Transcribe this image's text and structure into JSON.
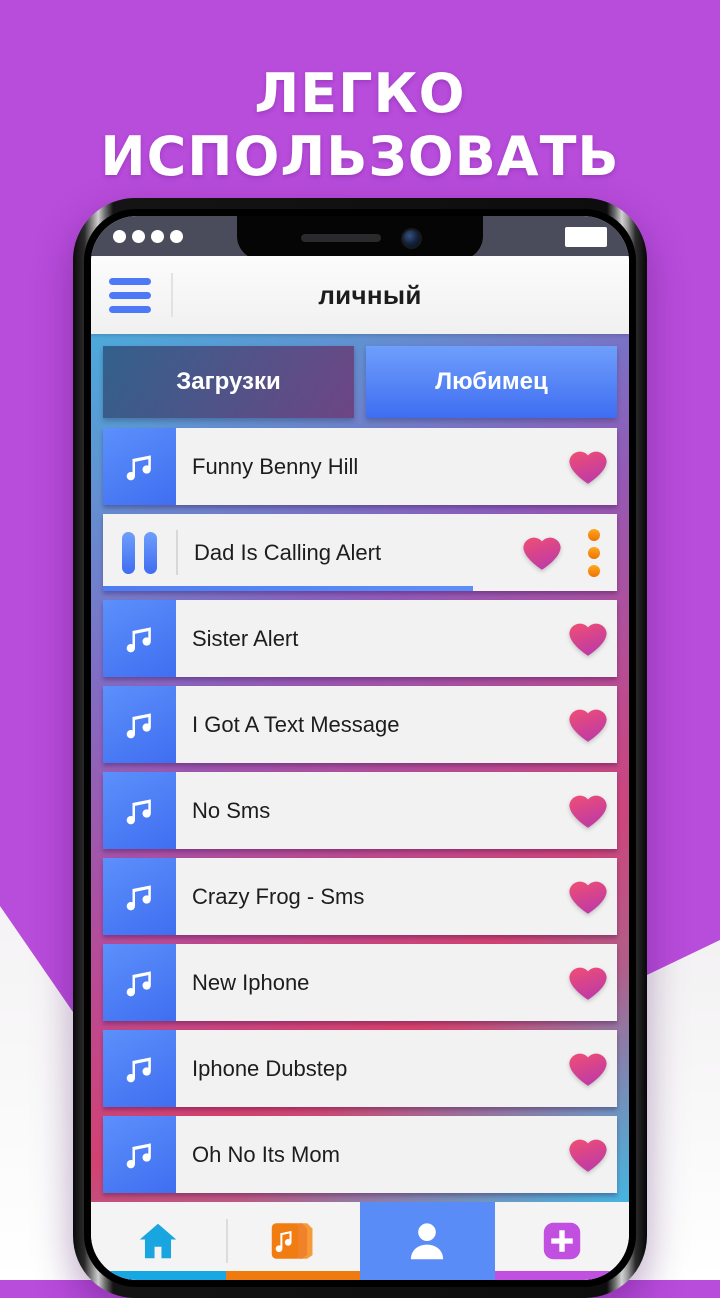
{
  "promo": {
    "headline": "ЛЕГКО ИСПОЛЬЗОВАТЬ",
    "background_color": "#b84cdb",
    "headline_color": "#ffffff"
  },
  "status_bar": {
    "signal_dots": 4,
    "battery_icon": "battery-icon",
    "background_color": "#4b4c5b"
  },
  "app_bar": {
    "menu_icon": "hamburger-menu-icon",
    "title": "личный",
    "accent_color": "#4d79f6"
  },
  "tabs": [
    {
      "label": "Загрузки",
      "active": false
    },
    {
      "label": "Любимец",
      "active": true
    }
  ],
  "songs": [
    {
      "title": "Funny Benny Hill",
      "icon": "music-note-icon",
      "favorite": true,
      "playing": false
    },
    {
      "title": "Dad Is Calling Alert",
      "icon": "pause-icon",
      "favorite": true,
      "playing": true,
      "progress": 72,
      "overflow_icon": "more-vertical-icon"
    },
    {
      "title": "Sister Alert",
      "icon": "music-note-icon",
      "favorite": true,
      "playing": false
    },
    {
      "title": "I Got A Text Message",
      "icon": "music-note-icon",
      "favorite": true,
      "playing": false
    },
    {
      "title": "No Sms",
      "icon": "music-note-icon",
      "favorite": true,
      "playing": false
    },
    {
      "title": "Crazy Frog - Sms",
      "icon": "music-note-icon",
      "favorite": true,
      "playing": false
    },
    {
      "title": "New Iphone",
      "icon": "music-note-icon",
      "favorite": true,
      "playing": false
    },
    {
      "title": "Iphone Dubstep",
      "icon": "music-note-icon",
      "favorite": true,
      "playing": false
    },
    {
      "title": "Oh No Its Mom",
      "icon": "music-note-icon",
      "favorite": true,
      "playing": false
    }
  ],
  "bottom_nav": [
    {
      "icon": "home-icon",
      "color": "#19a6e0",
      "active": false
    },
    {
      "icon": "music-stack-icon",
      "color": "#f07c12",
      "active": false
    },
    {
      "icon": "person-icon",
      "color": "#5a8cf7",
      "active": true
    },
    {
      "icon": "plus-square-icon",
      "color": "#c14fe0",
      "active": false
    }
  ],
  "colors": {
    "heart": "#e8446f",
    "heart_deep": "#c43a9c",
    "tab_active": "#4d79f6",
    "overflow_dot": "#f58b0d"
  }
}
